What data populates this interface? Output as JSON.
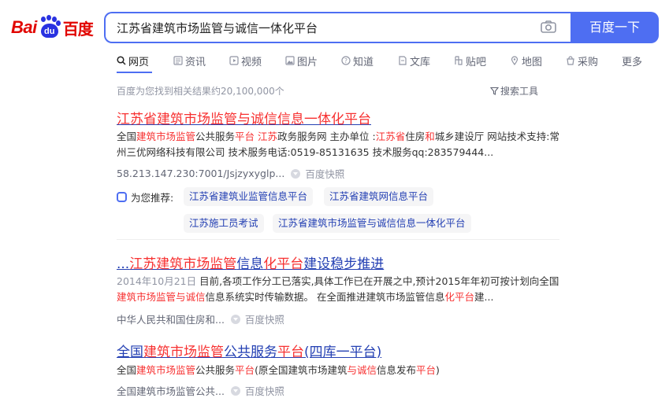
{
  "logo": {
    "bai": "Bai",
    "du": "du",
    "paw_text": "du",
    "cn": "百度"
  },
  "search": {
    "query": "江苏省建筑市场监管与诚信一体化平台",
    "button": "百度一下"
  },
  "tabs": [
    {
      "label": "网页",
      "icon": "search-icon"
    },
    {
      "label": "资讯",
      "icon": "news-icon"
    },
    {
      "label": "视频",
      "icon": "video-icon"
    },
    {
      "label": "图片",
      "icon": "image-icon"
    },
    {
      "label": "知道",
      "icon": "question-icon"
    },
    {
      "label": "文库",
      "icon": "document-icon"
    },
    {
      "label": "贴吧",
      "icon": "tieba-icon"
    },
    {
      "label": "地图",
      "icon": "map-icon"
    },
    {
      "label": "采购",
      "icon": "shopping-icon"
    },
    {
      "label": "更多",
      "icon": ""
    }
  ],
  "result_count": "百度为您找到相关结果约20,100,000个",
  "search_tools": "搜索工具",
  "results": [
    {
      "title": "江苏省建筑市场监管与诚信信息一体化平台",
      "snippet": {
        "p1": "全国",
        "e1": "建筑市场监管",
        "p2": "公共服务",
        "e2": "平台",
        "p3": " ",
        "e3": "江苏",
        "p4": "政务服务网 主办单位 :",
        "e4": "江苏省",
        "p5": "住房",
        "e5": "和",
        "p6": "城乡建设厅 网站技术支持:常州三优网络科技有限公司 技术服务电话:0519-85131635 技术服务qq:283579444..."
      },
      "url": "58.213.147.230:7001/Jsjzyxyglp...",
      "cache": "百度快照"
    },
    {
      "title": {
        "p1": "...",
        "e1": "江苏建筑市场监管",
        "p2": "信息",
        "e2": "化平台",
        "p3": "建设稳步推进"
      },
      "snippet": {
        "date": "2014年10月21日",
        "p1": " 目前,各项工作分工已落实,具体工作已在开展之中,预计2015年年初可按计划向全国",
        "e1": "建筑市场监管与诚信",
        "p2": "信息系统实时传输数据。 在全面推进建筑市场监管信息",
        "e2": "化平台",
        "p3": "建..."
      },
      "url": "中华人民共和国住房和...",
      "cache": "百度快照"
    },
    {
      "title": {
        "p1": "全国",
        "e1": "建筑市场监管",
        "p2": "公共服务",
        "e2": "平台",
        "p3": "(四库一平台)"
      },
      "snippet": {
        "p1": "全国",
        "e1": "建筑市场监管",
        "p2": "公共服务",
        "e2": "平台",
        "p3": "(原全国建筑市场建筑",
        "e3": "与诚信",
        "p4": "信息发布",
        "e4": "平台",
        "p5": ")"
      },
      "url": "全国建筑市场监管公共...",
      "cache": "百度快照"
    }
  ],
  "recommend": {
    "label": "为您推荐:",
    "chips": [
      "江苏省建筑业监管信息平台",
      "江苏省建筑网信息平台",
      "江苏施工员考试",
      "江苏省建筑市场监管与诚信信息一体化平台"
    ]
  },
  "colors": {
    "accent": "#4e6ef2",
    "link": "#2440b3",
    "highlight": "#f73131",
    "logo_red": "#e10601",
    "logo_blue": "#2932e1"
  }
}
